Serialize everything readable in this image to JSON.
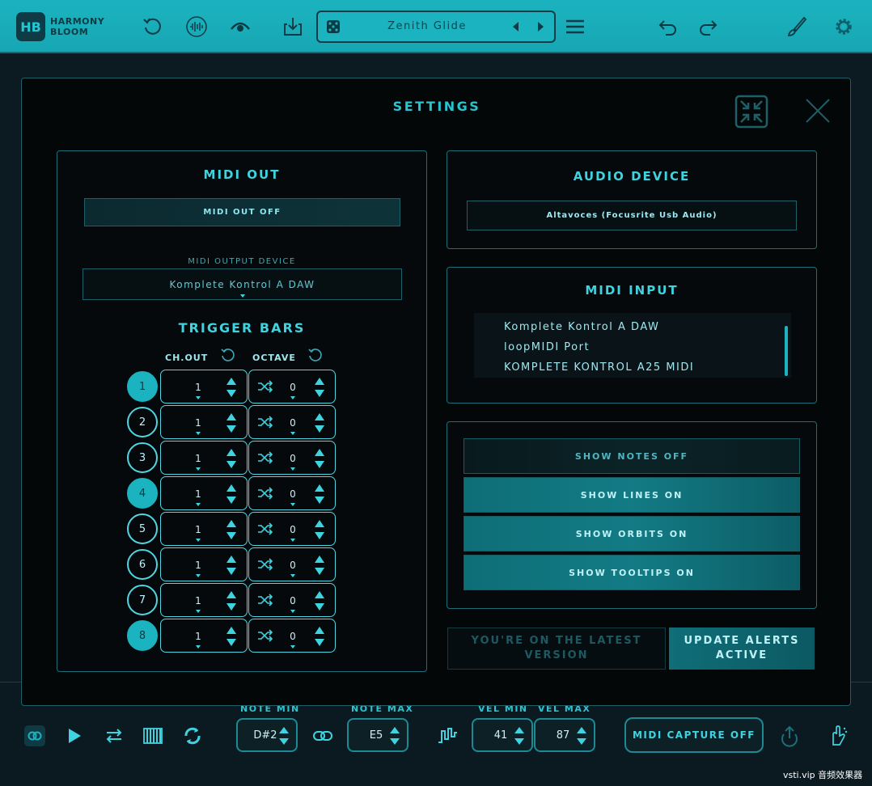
{
  "app": {
    "logo_mark": "HB",
    "logo_line1": "HARMONY",
    "logo_line2": "BLOOM",
    "preset_name": "Zenith Glide"
  },
  "modal": {
    "title": "SETTINGS"
  },
  "midi_out": {
    "title": "MIDI OUT",
    "toggle_label": "MIDI OUT OFF",
    "device_caption": "MIDI OUTPUT DEVICE",
    "device_value": "Komplete Kontrol A DAW"
  },
  "trigger_bars": {
    "title": "TRIGGER BARS",
    "ch_out_header": "CH.OUT",
    "octave_header": "OCTAVE",
    "rows": [
      {
        "num": "1",
        "ch": "1",
        "oct": "0",
        "active": true
      },
      {
        "num": "2",
        "ch": "1",
        "oct": "0",
        "active": false
      },
      {
        "num": "3",
        "ch": "1",
        "oct": "0",
        "active": false
      },
      {
        "num": "4",
        "ch": "1",
        "oct": "0",
        "active": true
      },
      {
        "num": "5",
        "ch": "1",
        "oct": "0",
        "active": false
      },
      {
        "num": "6",
        "ch": "1",
        "oct": "0",
        "active": false
      },
      {
        "num": "7",
        "ch": "1",
        "oct": "0",
        "active": false
      },
      {
        "num": "8",
        "ch": "1",
        "oct": "0",
        "active": true
      }
    ]
  },
  "audio_device": {
    "title": "AUDIO DEVICE",
    "value": "Altavoces (Focusrite Usb Audio)"
  },
  "midi_input": {
    "title": "MIDI INPUT",
    "items": [
      "Komplete Kontrol A DAW",
      "loopMIDI Port",
      "KOMPLETE KONTROL A25 MIDI"
    ]
  },
  "display_toggles": {
    "show_notes": "SHOW NOTES OFF",
    "show_lines": "SHOW LINES ON",
    "show_orbits": "SHOW ORBITS ON",
    "show_tooltips": "SHOW TOOLTIPS ON"
  },
  "version": {
    "status": "YOU'RE ON THE LATEST VERSION",
    "alerts": "UPDATE ALERTS ACTIVE"
  },
  "bottom": {
    "note_min_label": "NOTE MIN",
    "note_min": "D#2",
    "note_max_label": "NOTE MAX",
    "note_max": "E5",
    "vel_min_label": "VEL MIN",
    "vel_min": "41",
    "vel_max_label": "VEL MAX",
    "vel_max": "87",
    "midi_capture": "MIDI CAPTURE OFF"
  },
  "watermark": "vsti.vip 音频效果器",
  "colors": {
    "accent": "#1bb3bf",
    "panel_border": "#1c6f78",
    "background": "#030708"
  }
}
